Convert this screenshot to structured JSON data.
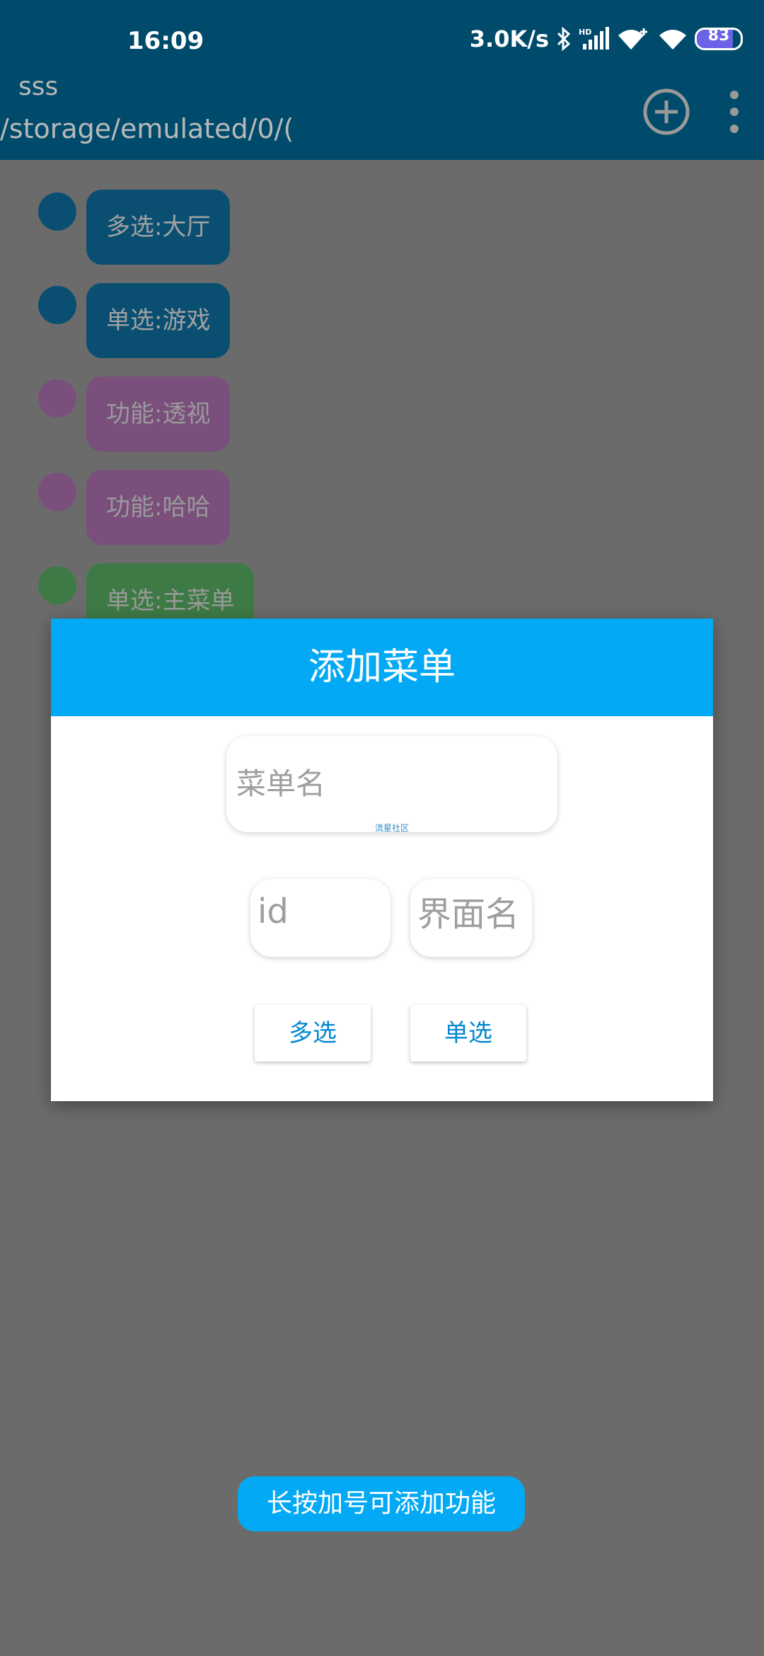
{
  "status_bar": {
    "time": "16:09",
    "net_speed": "3.0K/s",
    "battery_level": 83,
    "battery_label": "83",
    "icons": [
      "bluetooth-icon",
      "hd-signal-icon",
      "wifi-plus-icon",
      "wifi-icon",
      "battery-icon"
    ]
  },
  "app_bar": {
    "title": "sss",
    "path": "/storage/emulated/0/(",
    "actions": [
      "add-circle-icon",
      "more-vert-icon"
    ]
  },
  "menu_items": [
    {
      "label": "多选:大厅",
      "color": "#0a4f72"
    },
    {
      "label": "单选:游戏",
      "color": "#0a4f72"
    },
    {
      "label": "功能:透视",
      "color": "#7a4f7c"
    },
    {
      "label": "功能:哈哈",
      "color": "#7a4f7c"
    },
    {
      "label": "单选:主菜单",
      "color": "#3e7a45"
    }
  ],
  "dialog": {
    "title": "添加菜单",
    "menu_name_placeholder": "菜单名",
    "watermark": "流星社区",
    "id_placeholder": "id",
    "page_name_placeholder": "界面名",
    "multi_button": "多选",
    "single_button": "单选"
  },
  "toast": {
    "message": "长按加号可添加功能"
  },
  "colors": {
    "primary_dark": "#004b6b",
    "accent": "#03a9f4",
    "button_text": "#0288d1",
    "scrim": "#6b6b6b"
  }
}
